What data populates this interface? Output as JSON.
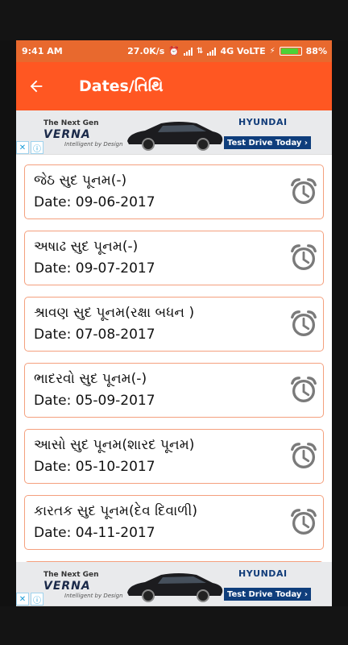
{
  "status_bar": {
    "time": "9:41 AM",
    "net_speed": "27.0K/s",
    "network": "4G VoLTE",
    "battery": "88%",
    "battery_level": 0.88,
    "battery_color": "#4cd137"
  },
  "app_bar": {
    "title": "Dates/તિથિ",
    "back_icon": "arrow-left-icon",
    "color": "#ff5722"
  },
  "ad": {
    "tagline_top": "The Next Gen",
    "model": "VERNA",
    "tagline_bottom": "Intelligent by Design",
    "brand": "HYUNDAI",
    "cta": "Test Drive Today ›"
  },
  "events": [
    {
      "name": "જેઠ સુદ પૂનમ(-)",
      "date": "Date: 09-06-2017"
    },
    {
      "name": "અષાઢ સુદ પૂનમ(-)",
      "date": "Date: 09-07-2017"
    },
    {
      "name": "શ્રાવણ સુદ પૂનમ(રક્ષા બધન )",
      "date": "Date: 07-08-2017"
    },
    {
      "name": "ભાદરવો સુદ પૂનમ(-)",
      "date": "Date: 05-09-2017"
    },
    {
      "name": "આસો સુદ પૂનમ(શારદ  પૂનમ)",
      "date": "Date: 05-10-2017"
    },
    {
      "name": "કારતક સુદ પૂનમ(દેવ દિવાળી)",
      "date": "Date: 04-11-2017"
    },
    {
      "name": "",
      "date": ""
    }
  ]
}
